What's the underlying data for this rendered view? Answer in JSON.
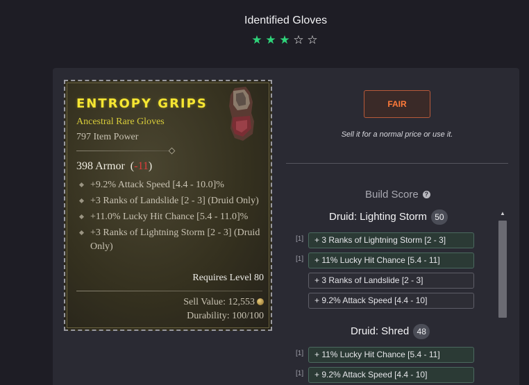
{
  "header": {
    "title": "Identified Gloves",
    "rating_stars": {
      "filled": 3,
      "total": 5
    }
  },
  "item": {
    "name": "ENTROPY GRIPS",
    "type": "Ancestral Rare Gloves",
    "power": "797 Item Power",
    "armor": "398 Armor",
    "armor_delta": "-11",
    "affixes": [
      "+9.2% Attack Speed [4.4 - 10.0]%",
      "+3 Ranks of Landslide [2 - 3] (Druid Only)",
      "+11.0% Lucky Hit Chance [5.4 - 11.0]%",
      "+3 Ranks of Lightning Storm [2 - 3] (Druid Only)"
    ],
    "requires_level": "Requires Level 80",
    "sell_value": "Sell Value: 12,553",
    "durability": "Durability: 100/100",
    "icon": "glove-icon",
    "name_color": "#f6e632"
  },
  "evaluation": {
    "rating": "FAIR",
    "rating_color": "#ff7a3a",
    "advice": "Sell it for a normal price or use it.",
    "build_score_label": "Build Score",
    "builds": [
      {
        "name": "Druid: Lighting Storm",
        "score": "50",
        "affixes": [
          {
            "tag": "[1]",
            "text": "+ 3 Ranks of Lightning Storm [2 - 3]",
            "matched": true
          },
          {
            "tag": "[1]",
            "text": "+ 11% Lucky Hit Chance [5.4 - 11]",
            "matched": true
          },
          {
            "tag": "",
            "text": "+ 3 Ranks of Landslide [2 - 3]",
            "matched": false
          },
          {
            "tag": "",
            "text": "+ 9.2% Attack Speed [4.4 - 10]",
            "matched": false
          }
        ]
      },
      {
        "name": "Druid: Shred",
        "score": "48",
        "affixes": [
          {
            "tag": "[1]",
            "text": "+ 11% Lucky Hit Chance [5.4 - 11]",
            "matched": true
          },
          {
            "tag": "[1]",
            "text": "+ 9.2% Attack Speed [4.4 - 10]",
            "matched": true
          }
        ]
      }
    ]
  },
  "colors": {
    "star_filled": "#2fd37a",
    "matched_pill": "#2b3a35"
  }
}
